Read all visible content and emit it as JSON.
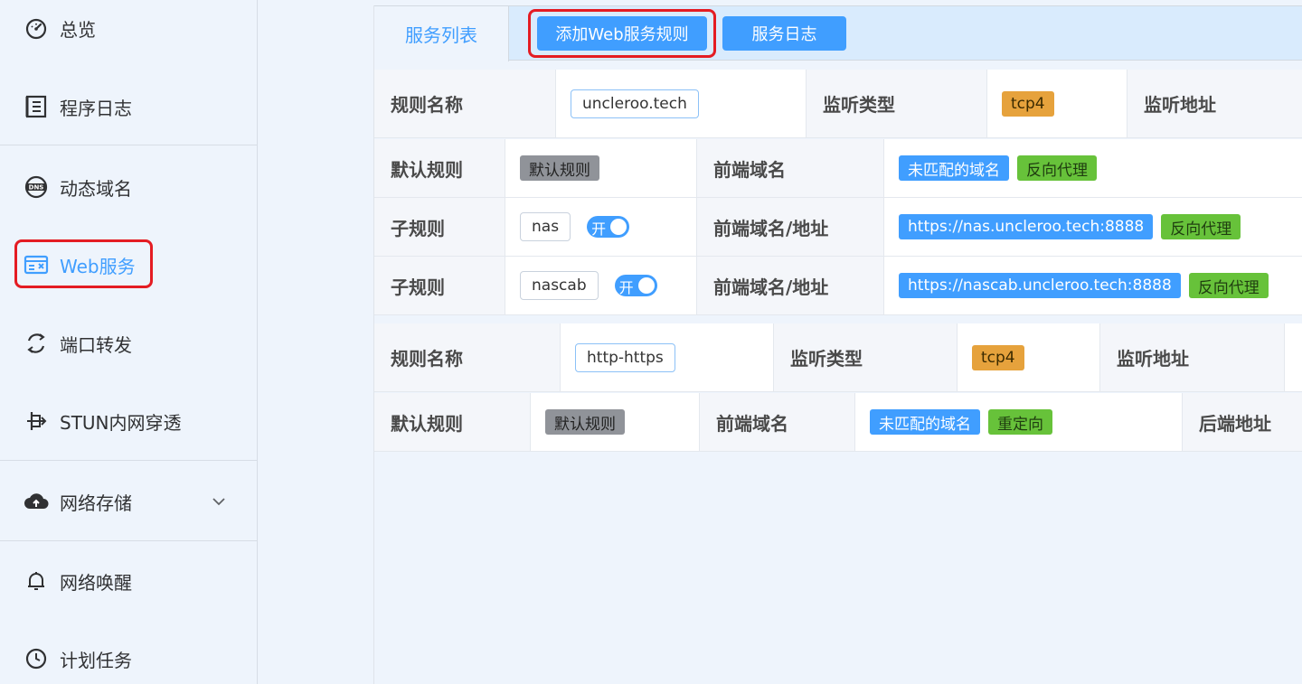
{
  "sidebar": {
    "items": [
      {
        "label": "总览",
        "icon": "dashboard-icon"
      },
      {
        "label": "程序日志",
        "icon": "log-icon"
      },
      {
        "label": "动态域名",
        "icon": "dns-icon"
      },
      {
        "label": "Web服务",
        "icon": "web-service-icon",
        "active": true
      },
      {
        "label": "端口转发",
        "icon": "port-forward-icon"
      },
      {
        "label": "STUN内网穿透",
        "icon": "stun-icon"
      },
      {
        "label": "网络存储",
        "icon": "cloud-upload-icon"
      },
      {
        "label": "网络唤醒",
        "icon": "bell-icon"
      },
      {
        "label": "计划任务",
        "icon": "clock-icon"
      }
    ]
  },
  "tabs": {
    "service_list": "服务列表",
    "add_rule": "添加Web服务规则",
    "service_log": "服务日志"
  },
  "rule1": {
    "name_label": "规则名称",
    "name_value": "uncleroo.tech",
    "listen_type_label": "监听类型",
    "listen_type_value": "tcp4",
    "listen_addr_label": "监听地址",
    "default_label": "默认规则",
    "default_tag": "默认规则",
    "frontend_label": "前端域名",
    "unmatched_tag": "未匹配的域名",
    "proxy_tag": "反向代理",
    "subrules": [
      {
        "label": "子规则",
        "name": "nas",
        "switch": "开",
        "frontend_label": "前端域名/地址",
        "url": "https://nas.uncleroo.tech:8888",
        "mode": "反向代理"
      },
      {
        "label": "子规则",
        "name": "nascab",
        "switch": "开",
        "frontend_label": "前端域名/地址",
        "url": "https://nascab.uncleroo.tech:8888",
        "mode": "反向代理"
      }
    ]
  },
  "rule2": {
    "name_label": "规则名称",
    "name_value": "http-https",
    "listen_type_label": "监听类型",
    "listen_type_value": "tcp4",
    "listen_addr_label": "监听地址",
    "default_label": "默认规则",
    "default_tag": "默认规则",
    "frontend_label": "前端域名",
    "unmatched_tag": "未匹配的域名",
    "redirect_tag": "重定向",
    "backend_label": "后端地址"
  },
  "colors": {
    "primary": "#409eff",
    "success": "#67c23a",
    "warning": "#e6a23c",
    "info": "#909399",
    "highlight": "#e41c23"
  }
}
